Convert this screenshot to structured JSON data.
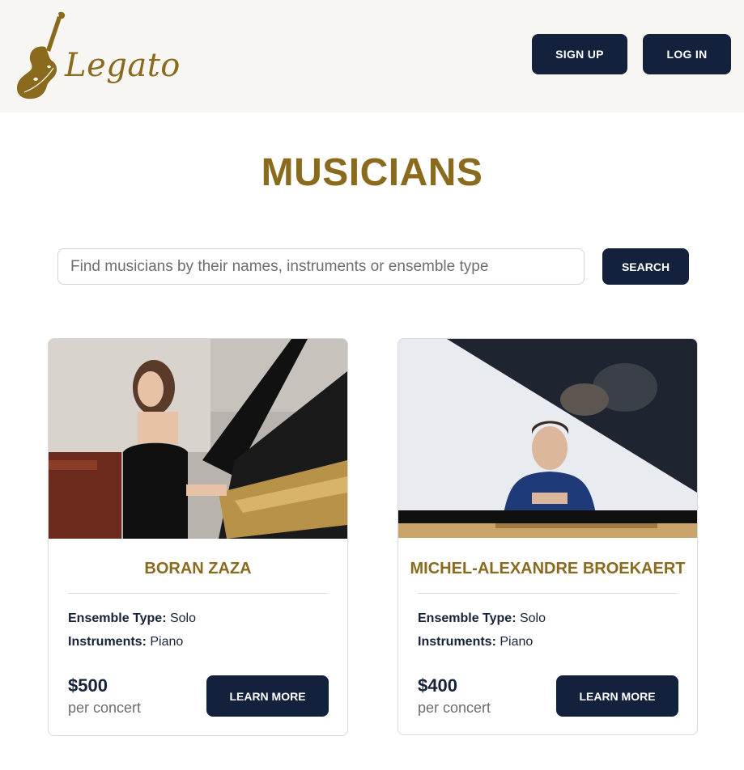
{
  "header": {
    "logo_text": "Legato",
    "signup_label": "SIGN UP",
    "login_label": "LOG IN"
  },
  "page_title": "MUSICIANS",
  "search": {
    "placeholder": "Find musicians by their names, instruments or ensemble type",
    "value": "",
    "button_label": "SEARCH"
  },
  "labels": {
    "ensemble_type": "Ensemble Type:",
    "instruments": "Instruments:"
  },
  "musicians": [
    {
      "name": "BORAN ZAZA",
      "ensemble_type": "Solo",
      "instruments": "Piano",
      "price": "$500",
      "price_unit": "per concert",
      "button_label": "LEARN MORE"
    },
    {
      "name": "MICHEL-ALEXANDRE BROEKAERT",
      "ensemble_type": "Solo",
      "instruments": "Piano",
      "price": "$400",
      "price_unit": "per concert",
      "button_label": "LEARN MORE"
    }
  ],
  "colors": {
    "brand_gold": "#8a6a1c",
    "navy": "#14213d",
    "header_bg": "#f8f6f3"
  },
  "icons": {
    "logo": "violin-icon"
  }
}
